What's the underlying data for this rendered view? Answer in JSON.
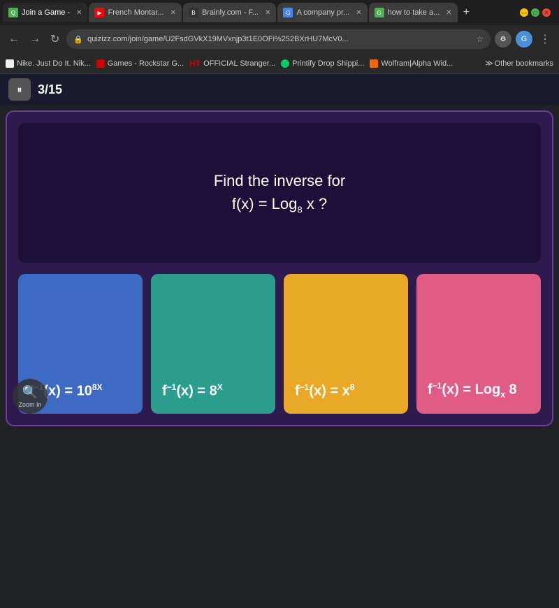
{
  "browser": {
    "tabs": [
      {
        "id": "tab-quizizz",
        "label": "Join a Game -",
        "favicon_color": "#4CAF50",
        "favicon_text": "Q",
        "active": true
      },
      {
        "id": "tab-french",
        "label": "French Montar...",
        "favicon_color": "#FF0000",
        "favicon_text": "▶",
        "active": false
      },
      {
        "id": "tab-brainly",
        "label": "Brainly.com - F...",
        "favicon_color": "#333",
        "favicon_text": "B",
        "active": false
      },
      {
        "id": "tab-company",
        "label": "A company pr...",
        "favicon_color": "#4285F4",
        "favicon_text": "G",
        "active": false
      },
      {
        "id": "tab-howtotake",
        "label": "how to take a...",
        "favicon_color": "#4CAF50",
        "favicon_text": "G",
        "active": false
      }
    ],
    "address_bar": {
      "url": "quizizz.com/join/game/U2FsdGVkX19MVxnjp3t1E0OFi%252BXrHU7McV0...",
      "lock_icon": "🔒"
    },
    "bookmarks": [
      {
        "label": "Nike. Just Do It. Nik...",
        "favicon_color": "#f0f0f0"
      },
      {
        "label": "Games - Rockstar G...",
        "favicon_color": "#cc0000"
      },
      {
        "label": "OFFICIAL Stranger...",
        "favicon_color": "#cc0000"
      },
      {
        "label": "Printify Drop Shippi...",
        "favicon_color": "#00cc66"
      },
      {
        "label": "Wolfram|Alpha Wid...",
        "favicon_color": "#ff6600"
      },
      {
        "label": "Other bookmarks"
      }
    ]
  },
  "quiz_controls": {
    "pause_icon": "⏸",
    "progress": "3/15"
  },
  "question": {
    "line1": "Find the inverse for",
    "line2": "f(x) = Log",
    "base": "8",
    "line2_end": " x ?"
  },
  "answers": [
    {
      "id": "answer-a",
      "color_class": "blue",
      "html_label": "f⁻¹(x) = 10<sup>8X</sup>",
      "text": "f⁻¹(x) = 10^8X"
    },
    {
      "id": "answer-b",
      "color_class": "teal",
      "html_label": "f⁻¹(x) = 8<sup>X</sup>",
      "text": "f⁻¹(x) = 8^X"
    },
    {
      "id": "answer-c",
      "color_class": "orange",
      "html_label": "f⁻¹(x) = x<sup>8</sup>",
      "text": "f⁻¹(x) = x^8"
    },
    {
      "id": "answer-d",
      "color_class": "pink",
      "html_label": "f⁻¹(x) = Log<sub>x</sub> 8",
      "text": "f⁻¹(x) = Log_x 8"
    }
  ],
  "zoom": {
    "icon": "🔍",
    "label": "Zoom In"
  }
}
